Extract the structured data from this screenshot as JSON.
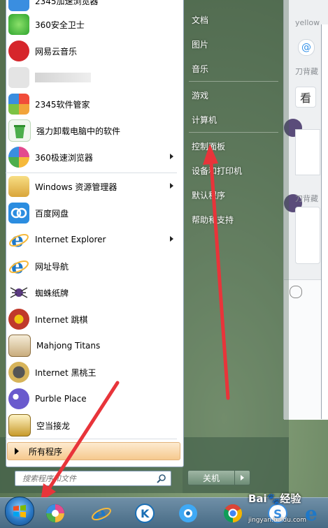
{
  "start_menu": {
    "top_item_partial": "2345加速浏览器",
    "programs": [
      {
        "label": "360安全卫士",
        "icon": "360-safe-icon",
        "color": "#2fa52f"
      },
      {
        "label": "网易云音乐",
        "icon": "netease-music-icon",
        "color": "#d6262b"
      },
      {
        "label": "",
        "icon": "blurred-app-icon",
        "color": "#cccccc"
      },
      {
        "label": "2345软件管家",
        "icon": "2345-manager-icon",
        "color": "#f2a43a"
      },
      {
        "label": "强力卸载电脑中的软件",
        "icon": "uninstall-recycle-icon",
        "color": "#3da33d"
      },
      {
        "label": "360极速浏览器",
        "icon": "360-speed-browser-icon",
        "color": "#e34b8e",
        "has_submenu": true
      },
      {
        "label": "Windows 资源管理器",
        "icon": "windows-explorer-icon",
        "color": "#e6c04e",
        "has_submenu": true
      },
      {
        "label": "百度网盘",
        "icon": "baidu-netdisk-icon",
        "color": "#2b8de0"
      },
      {
        "label": "Internet Explorer",
        "icon": "internet-explorer-icon",
        "color": "#1e78c8",
        "has_submenu": true
      },
      {
        "label": "网址导航",
        "icon": "url-nav-icon",
        "color": "#1e78c8"
      },
      {
        "label": "蜘蛛纸牌",
        "icon": "spider-solitaire-icon",
        "color": "#7a4aa0"
      },
      {
        "label": "Internet 跳棋",
        "icon": "internet-checkers-icon",
        "color": "#c0392b"
      },
      {
        "label": "Mahjong Titans",
        "icon": "mahjong-titans-icon",
        "color": "#b08a55"
      },
      {
        "label": "Internet 黑桃王",
        "icon": "internet-spades-icon",
        "color": "#333333"
      },
      {
        "label": "Purble Place",
        "icon": "purble-place-icon",
        "color": "#6a5acd"
      },
      {
        "label": "空当接龙",
        "icon": "freecell-icon",
        "color": "#c79a2b"
      }
    ],
    "all_programs": "所有程序",
    "search_placeholder": "搜索程序和文件",
    "right_items": [
      "文档",
      "图片",
      "音乐",
      "游戏",
      "计算机",
      "控制面板",
      "设备和打印机",
      "默认程序",
      "帮助和支持"
    ],
    "shutdown": "关机"
  },
  "chat": {
    "name1": "yellow",
    "name2": "刀背藏",
    "name3": "刀背藏",
    "bubble1": "看"
  },
  "watermark": {
    "brand": "Bai\u0000经验",
    "url": "jingyan.baidu.com"
  },
  "taskbar": {
    "apps": [
      "start-orb",
      "360-browser-taskbar-icon",
      "ie-taskbar-icon",
      "kuaibo-taskbar-icon",
      "video-taskbar-icon",
      "chrome-taskbar-icon",
      "paint-taskbar-icon",
      "sogou-taskbar-icon",
      "ie2-taskbar-icon"
    ]
  },
  "colors": {
    "arrow_red": "#e8343a",
    "menu_highlight": "#f6c98e"
  }
}
